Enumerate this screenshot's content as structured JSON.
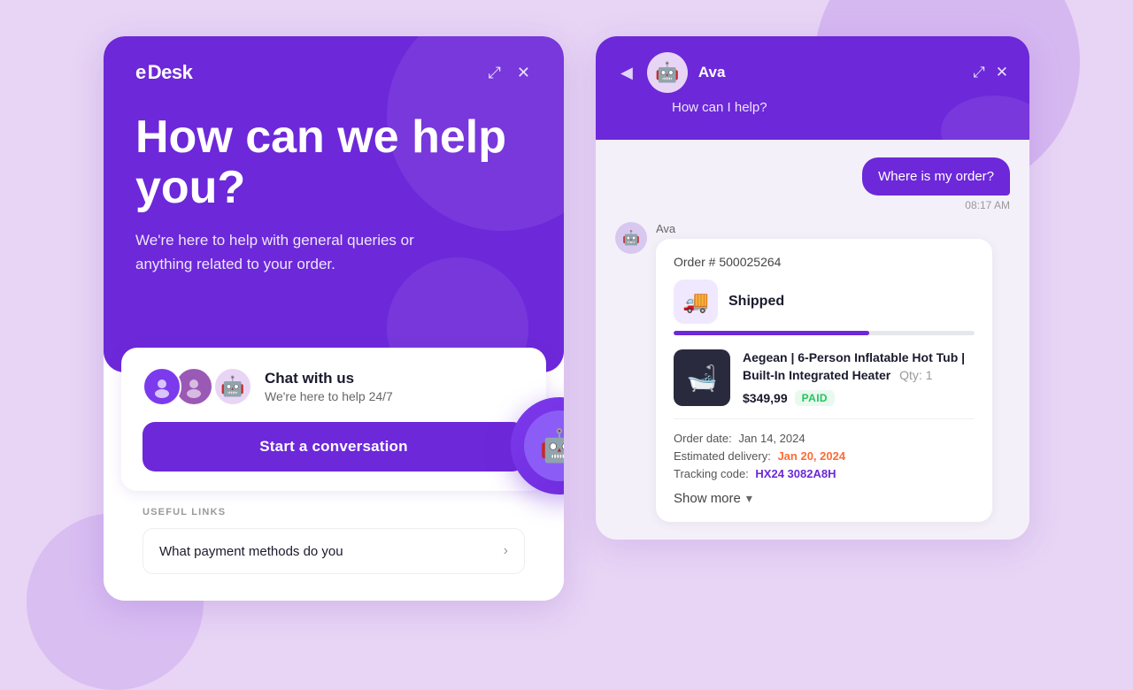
{
  "background": {
    "color": "#e8d5f5"
  },
  "left_panel": {
    "logo": {
      "prefix": "e",
      "name": "Desk"
    },
    "header_icons": {
      "expand": "⤢",
      "close": "✕"
    },
    "hero": {
      "title": "How can we help you?",
      "subtitle": "We're here to help with general queries or anything related to your order."
    },
    "chat_card": {
      "title": "Chat with us",
      "subtitle": "We're here to help 24/7",
      "button_label": "Start a conversation"
    },
    "useful_links": {
      "section_label": "USEFUL LINKS",
      "items": [
        {
          "text": "What payment methods do you"
        }
      ]
    }
  },
  "right_panel": {
    "header": {
      "back_icon": "◀",
      "agent_name": "Ava",
      "subtitle": "How can I help?",
      "expand_icon": "⤢",
      "close_icon": "✕"
    },
    "messages": [
      {
        "type": "user",
        "text": "Where is my order?",
        "time": "08:17 AM"
      },
      {
        "type": "agent",
        "sender": "Ava",
        "order": {
          "number": "Order # 500025264",
          "status": "Shipped",
          "product_name": "Aegean | 6-Person Inflatable Hot Tub | Built-In Integrated Heater",
          "qty": "Qty: 1",
          "price": "$349,99",
          "paid_label": "PAID",
          "order_date_label": "Order date:",
          "order_date_value": "Jan 14, 2024",
          "delivery_label": "Estimated delivery:",
          "delivery_value": "Jan 20, 2024",
          "tracking_label": "Tracking code:",
          "tracking_value": "HX24 3082A8H",
          "progress_pct": 65
        }
      }
    ],
    "show_more": "Show more"
  }
}
